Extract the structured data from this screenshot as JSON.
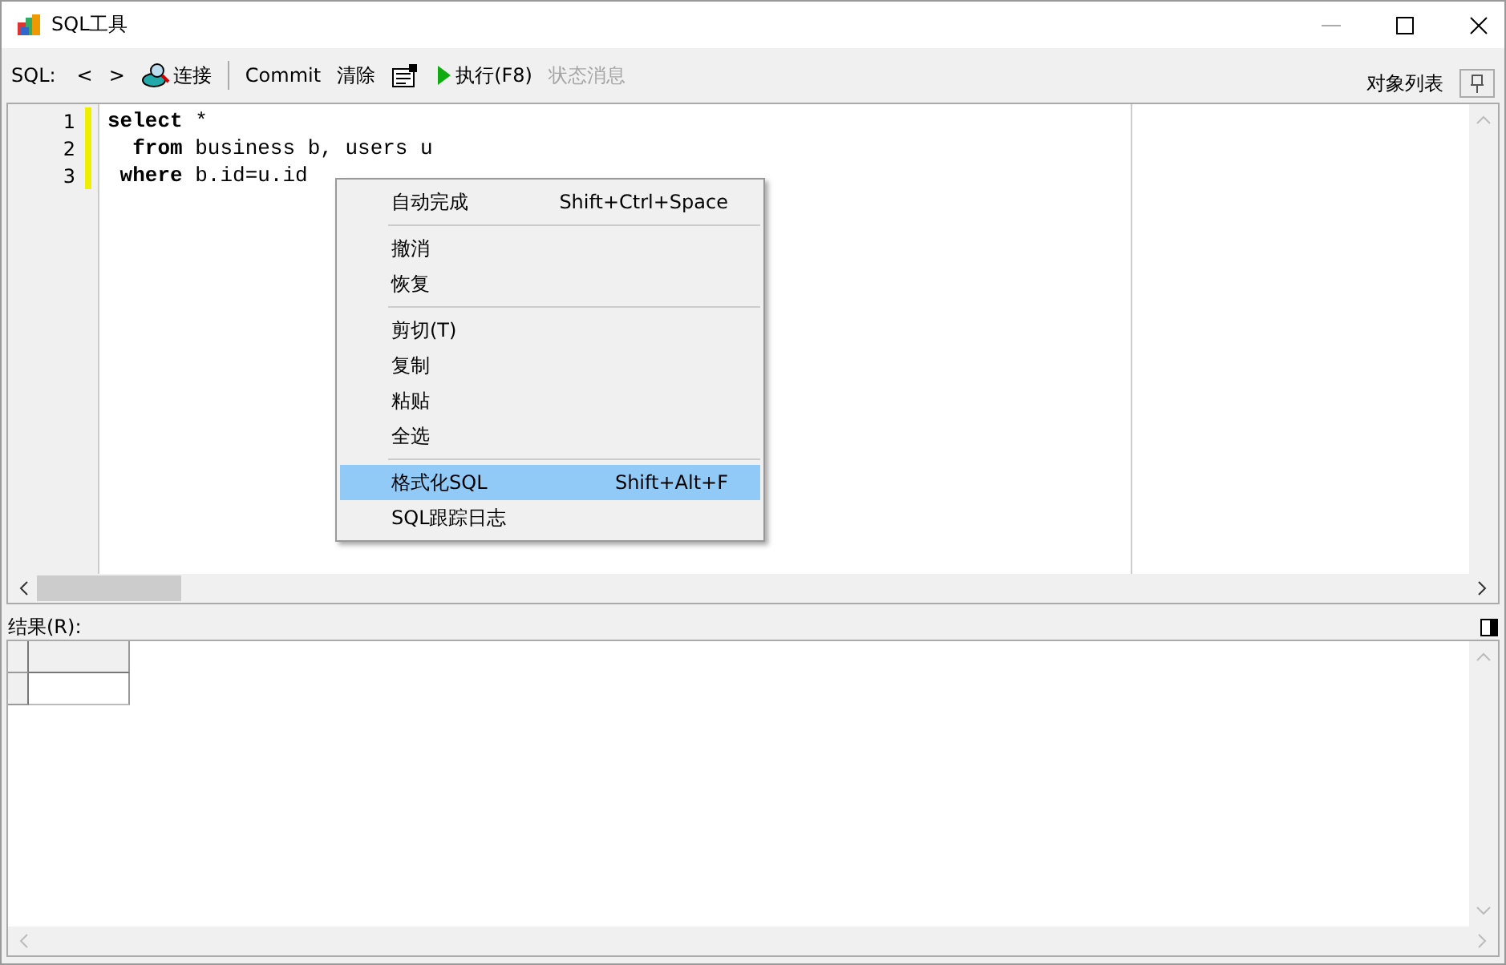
{
  "window": {
    "title": "SQL工具"
  },
  "toolbar": {
    "items": [
      {
        "kind": "label",
        "text": "SQL:"
      },
      {
        "kind": "button",
        "text": "<",
        "disabled": false
      },
      {
        "kind": "button",
        "text": ">",
        "disabled": false
      },
      {
        "kind": "connect",
        "text": "连接",
        "disabled": false
      },
      {
        "kind": "separator"
      },
      {
        "kind": "button",
        "text": "Commit",
        "disabled": false
      },
      {
        "kind": "button",
        "text": "清除",
        "disabled": false
      },
      {
        "kind": "form"
      },
      {
        "kind": "run",
        "text": "执行(F8)",
        "disabled": false
      },
      {
        "kind": "button",
        "text": "状态消息",
        "disabled": true
      }
    ],
    "object_list": "对象列表"
  },
  "editor": {
    "lines": [
      {
        "number": "1",
        "tokens": [
          {
            "text": "select",
            "keyword": true
          },
          {
            "text": " *",
            "keyword": false
          }
        ]
      },
      {
        "number": "2",
        "tokens": [
          {
            "text": "  from",
            "keyword": true
          },
          {
            "text": " business b, users u",
            "keyword": false
          }
        ]
      },
      {
        "number": "3",
        "tokens": [
          {
            "text": " where",
            "keyword": true
          },
          {
            "text": " b.id=u.id",
            "keyword": false
          }
        ]
      }
    ]
  },
  "context_menu": [
    {
      "kind": "item",
      "label": "自动完成",
      "shortcut": "Shift+Ctrl+Space",
      "selected": false
    },
    {
      "kind": "separator"
    },
    {
      "kind": "item",
      "label": "撤消",
      "selected": false
    },
    {
      "kind": "item",
      "label": "恢复",
      "selected": false
    },
    {
      "kind": "separator"
    },
    {
      "kind": "item",
      "label": "剪切(T)",
      "selected": false
    },
    {
      "kind": "item",
      "label": "复制",
      "selected": false
    },
    {
      "kind": "item",
      "label": "粘贴",
      "selected": false
    },
    {
      "kind": "item",
      "label": "全选",
      "selected": false
    },
    {
      "kind": "separator"
    },
    {
      "kind": "item",
      "label": "格式化SQL",
      "shortcut": "Shift+Alt+F",
      "selected": true
    },
    {
      "kind": "item",
      "label": "SQL跟踪日志",
      "selected": false
    }
  ],
  "results": {
    "label": "结果(R):"
  }
}
